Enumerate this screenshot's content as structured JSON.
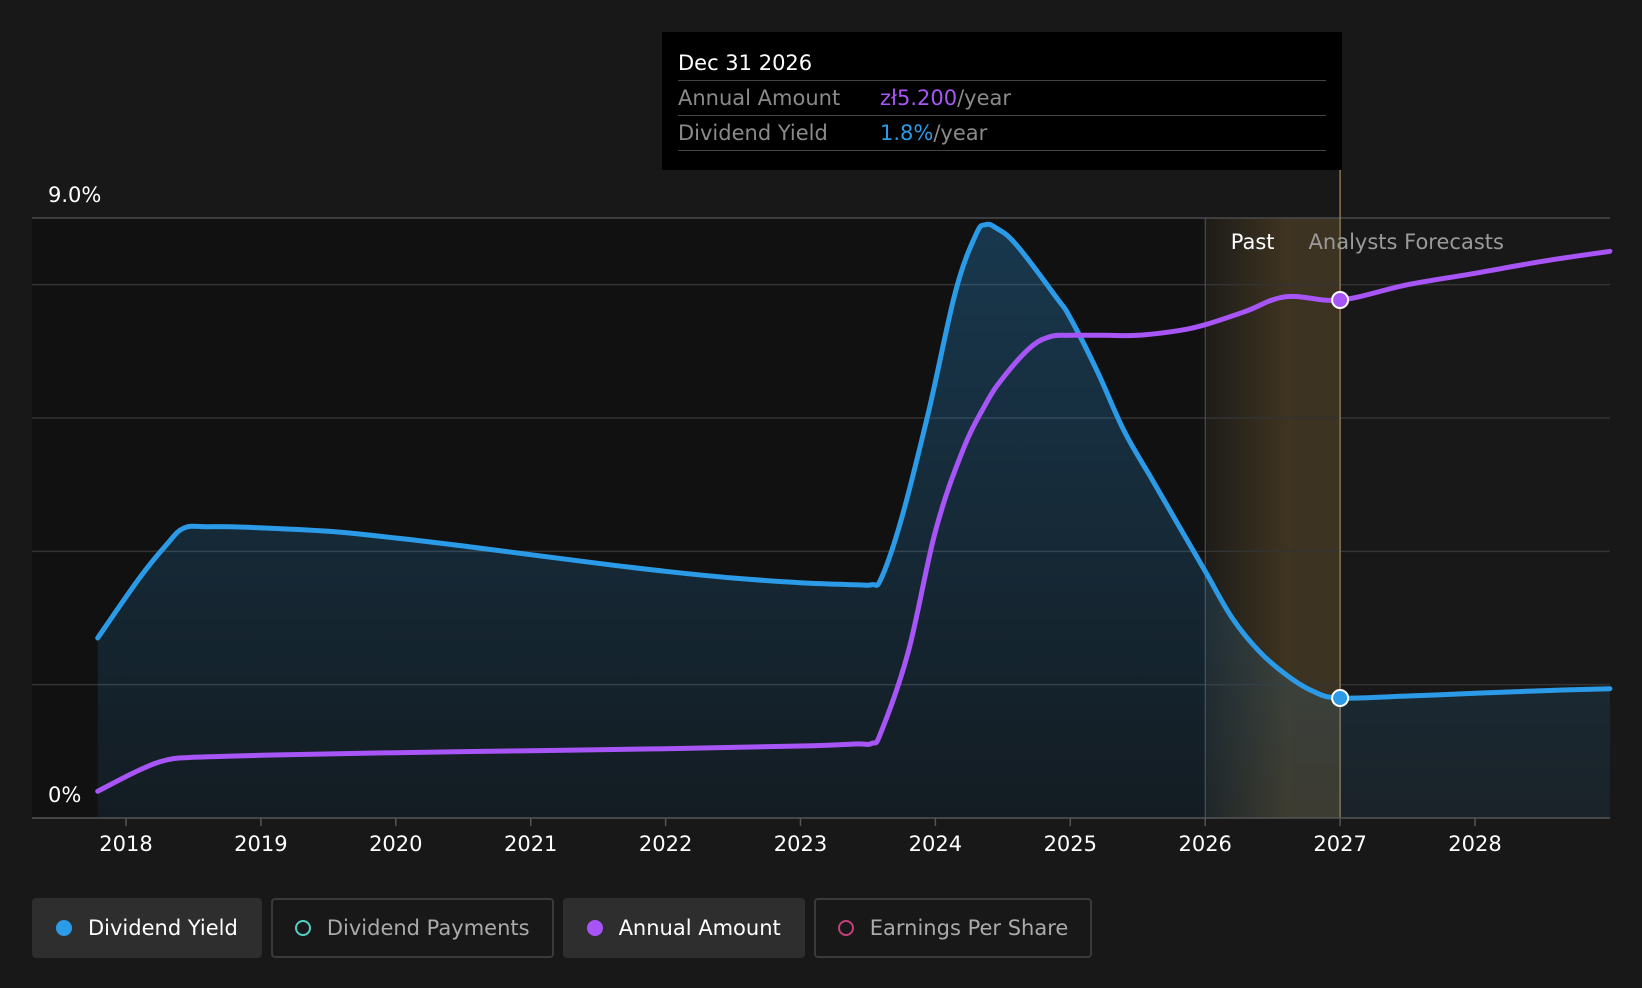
{
  "tooltip": {
    "date": "Dec 31 2026",
    "annual_amount_label": "Annual Amount",
    "annual_amount_value": "zł5.200",
    "annual_amount_unit": "/year",
    "dividend_yield_label": "Dividend Yield",
    "dividend_yield_value": "1.8%",
    "dividend_yield_unit": "/year"
  },
  "regions": {
    "past_label": "Past",
    "forecast_label": "Analysts Forecasts"
  },
  "legend": [
    {
      "label": "Dividend Yield",
      "color": "#2b9be8",
      "state": "active",
      "marker": "filled"
    },
    {
      "label": "Dividend Payments",
      "color": "#4fd1c5",
      "state": "inactive",
      "marker": "hollow"
    },
    {
      "label": "Annual Amount",
      "color": "#a855f7",
      "state": "active",
      "marker": "filled"
    },
    {
      "label": "Earnings Per Share",
      "color": "#c2417a",
      "state": "inactive",
      "marker": "hollow"
    }
  ],
  "colors": {
    "dividend_yield": "#2b9be8",
    "annual_amount": "#a855f7",
    "background": "#181818",
    "grid": "#333333"
  },
  "chart_data": {
    "type": "line",
    "xlim": [
      2017.75,
      2029.0
    ],
    "ylim": [
      0,
      9.0
    ],
    "y_tick_labels": [
      "0%",
      "9.0%"
    ],
    "y_ticks": [
      0,
      9.0
    ],
    "x_ticks": [
      2018,
      2019,
      2020,
      2021,
      2022,
      2023,
      2024,
      2025,
      2026,
      2027,
      2028
    ],
    "x_tick_labels": [
      "2018",
      "2019",
      "2020",
      "2021",
      "2022",
      "2023",
      "2024",
      "2025",
      "2026",
      "2027",
      "2028"
    ],
    "grid": true,
    "gridlines_y": [
      2.0,
      4.0,
      6.0,
      8.0,
      9.0
    ],
    "past_forecast_boundary": 2026.0,
    "highlight_start": 2026.64,
    "highlight_end": 2027.0,
    "series": [
      {
        "name": "Dividend Yield",
        "area": true,
        "x": [
          2017.79,
          2018.1,
          2018.3,
          2018.43,
          2018.6,
          2018.9,
          2019.5,
          2020.0,
          2020.5,
          2021.0,
          2021.5,
          2022.0,
          2022.5,
          2023.0,
          2023.4,
          2023.53,
          2023.6,
          2023.75,
          2023.95,
          2024.15,
          2024.3,
          2024.37,
          2024.45,
          2024.6,
          2024.9,
          2025.0,
          2025.2,
          2025.4,
          2025.6,
          2025.8,
          2026.0,
          2026.2,
          2026.4,
          2026.6,
          2026.8,
          2027.0,
          2027.5,
          2028.0,
          2028.5,
          2029.0
        ],
        "y": [
          2.7,
          3.6,
          4.1,
          4.35,
          4.37,
          4.36,
          4.3,
          4.2,
          4.08,
          3.95,
          3.82,
          3.7,
          3.6,
          3.53,
          3.5,
          3.5,
          3.6,
          4.5,
          6.1,
          7.9,
          8.75,
          8.9,
          8.85,
          8.6,
          7.8,
          7.5,
          6.7,
          5.8,
          5.1,
          4.4,
          3.7,
          3.0,
          2.5,
          2.15,
          1.9,
          1.8,
          1.83,
          1.87,
          1.91,
          1.94
        ]
      },
      {
        "name": "Annual Amount",
        "area": false,
        "x": [
          2017.79,
          2018.1,
          2018.3,
          2018.5,
          2019.0,
          2020.0,
          2021.0,
          2022.0,
          2023.0,
          2023.4,
          2023.53,
          2023.6,
          2023.8,
          2024.0,
          2024.2,
          2024.37,
          2024.5,
          2024.7,
          2024.85,
          2025.0,
          2025.25,
          2025.5,
          2025.8,
          2026.0,
          2026.3,
          2026.6,
          2027.0,
          2027.5,
          2028.0,
          2028.5,
          2029.0
        ],
        "y": [
          0.4,
          0.72,
          0.87,
          0.91,
          0.94,
          0.98,
          1.01,
          1.04,
          1.08,
          1.11,
          1.12,
          1.3,
          2.5,
          4.3,
          5.5,
          6.2,
          6.6,
          7.05,
          7.22,
          7.24,
          7.24,
          7.24,
          7.31,
          7.4,
          7.6,
          7.82,
          7.77,
          8.0,
          8.17,
          8.35,
          8.5
        ]
      }
    ],
    "markers": [
      {
        "series": "Annual Amount",
        "x": 2027.0,
        "y": 7.77
      },
      {
        "series": "Dividend Yield",
        "x": 2027.0,
        "y": 1.8
      }
    ]
  }
}
